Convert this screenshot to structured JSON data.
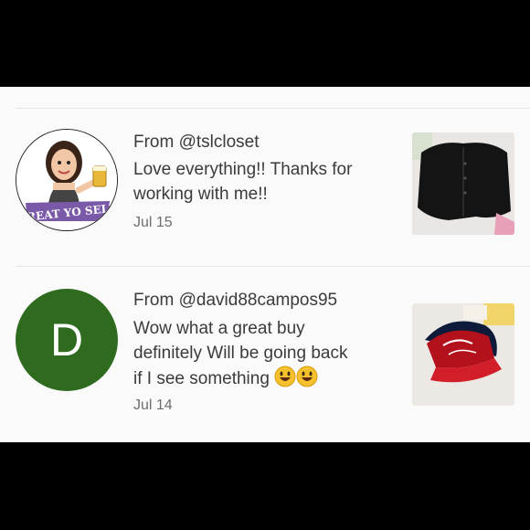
{
  "reviews": [
    {
      "from": "From @tslcloset",
      "message": "Love everything!! Thanks for working with me!!",
      "date": "Jul 15",
      "avatar_type": "bitmoji-image",
      "avatar_caption": "TREAT YO SELF",
      "thumbnail": "black-shirt-photo"
    },
    {
      "from": "From @david88campos95",
      "message_line1": "Wow what a great buy",
      "message_line2": "definitely Will be going back",
      "message_line3": "if I see something",
      "emojis": [
        "😃",
        "😃"
      ],
      "date": "Jul 14",
      "avatar_letter": "D",
      "avatar_color": "#2f6b1f",
      "thumbnail": "red-cap-photo"
    }
  ]
}
